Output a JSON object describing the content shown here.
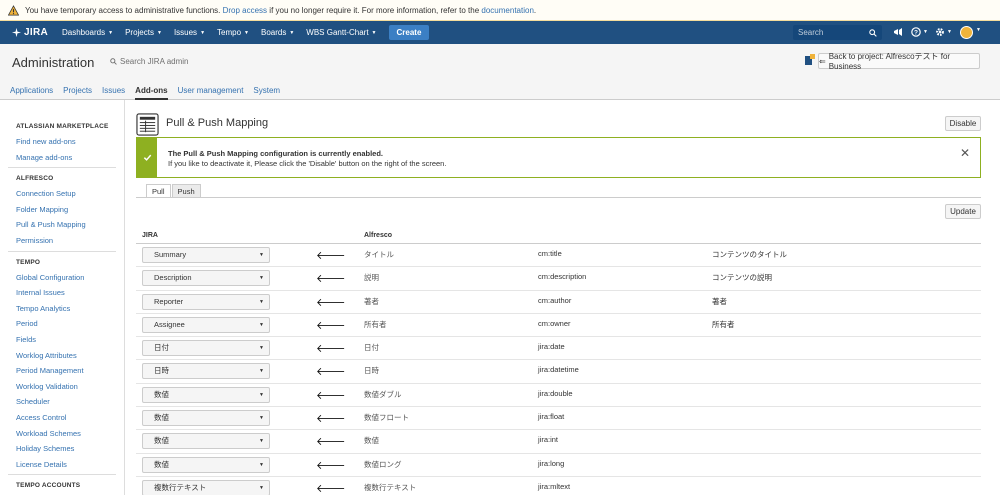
{
  "banner": {
    "text_before": "You have temporary access to administrative functions.",
    "link_drop": "Drop access",
    "text_middle": "if you no longer require it. For more information, refer to the",
    "link_doc": "documentation",
    "text_end": ".",
    "color": "#f4dc9c"
  },
  "topnav": {
    "logo": "JIRA",
    "items": [
      "Dashboards",
      "Projects",
      "Issues",
      "Tempo",
      "Boards",
      "WBS Gantt-Chart"
    ],
    "create_label": "Create",
    "search_placeholder": "Search",
    "bg_color": "#205081"
  },
  "admin": {
    "title": "Administration",
    "search_placeholder": "Search JIRA admin",
    "back_button": "Back to project: Alfrescoテスト for Business",
    "tabs": [
      "Applications",
      "Projects",
      "Issues",
      "Add-ons",
      "User management",
      "System"
    ],
    "active_tab": "Add-ons"
  },
  "sidebar": {
    "sections": [
      {
        "heading": "ATLASSIAN MARKETPLACE",
        "items": [
          "Find new add-ons",
          "Manage add-ons"
        ]
      },
      {
        "heading": "ALFRESCO",
        "items": [
          "Connection Setup",
          "Folder Mapping",
          "Pull & Push Mapping",
          "Permission"
        ]
      },
      {
        "heading": "TEMPO",
        "items": [
          "Global Configuration",
          "Internal Issues",
          "Tempo Analytics",
          "Period",
          "Fields",
          "Worklog Attributes",
          "Period Management",
          "Worklog Validation",
          "Scheduler",
          "Access Control",
          "Workload Schemes",
          "Holiday Schemes",
          "License Details"
        ]
      },
      {
        "heading": "TEMPO ACCOUNTS",
        "items": []
      }
    ]
  },
  "main": {
    "title": "Pull & Push Mapping",
    "disable_button": "Disable",
    "message": {
      "title": "The Pull & Push Mapping configuration is currently enabled.",
      "text": "If you like to deactivate it, Please click the 'Disable' button on the right of the screen.",
      "color": "#8eb021"
    },
    "tabs": [
      "Pull",
      "Push"
    ],
    "active_tab": "Pull",
    "update_button": "Update",
    "table": {
      "headers": [
        "JIRA",
        "Alfresco"
      ],
      "rows": [
        {
          "jira": "Summary",
          "label": "タイトル",
          "prop": "cm:title",
          "desc": "コンテンツのタイトル"
        },
        {
          "jira": "Description",
          "label": "説明",
          "prop": "cm:description",
          "desc": "コンテンツの説明"
        },
        {
          "jira": "Reporter",
          "label": "著者",
          "prop": "cm:author",
          "desc": "著者"
        },
        {
          "jira": "Assignee",
          "label": "所有者",
          "prop": "cm:owner",
          "desc": "所有者"
        },
        {
          "jira": "日付",
          "label": "日付",
          "prop": "jira:date",
          "desc": ""
        },
        {
          "jira": "日時",
          "label": "日時",
          "prop": "jira:datetime",
          "desc": ""
        },
        {
          "jira": "数値",
          "label": "数値ダブル",
          "prop": "jira:double",
          "desc": ""
        },
        {
          "jira": "数値",
          "label": "数値フロート",
          "prop": "jira:float",
          "desc": ""
        },
        {
          "jira": "数値",
          "label": "数値",
          "prop": "jira:int",
          "desc": ""
        },
        {
          "jira": "数値",
          "label": "数値ロング",
          "prop": "jira:long",
          "desc": ""
        },
        {
          "jira": "複数行テキスト",
          "label": "複数行テキスト",
          "prop": "jira:mltext",
          "desc": ""
        }
      ]
    }
  }
}
